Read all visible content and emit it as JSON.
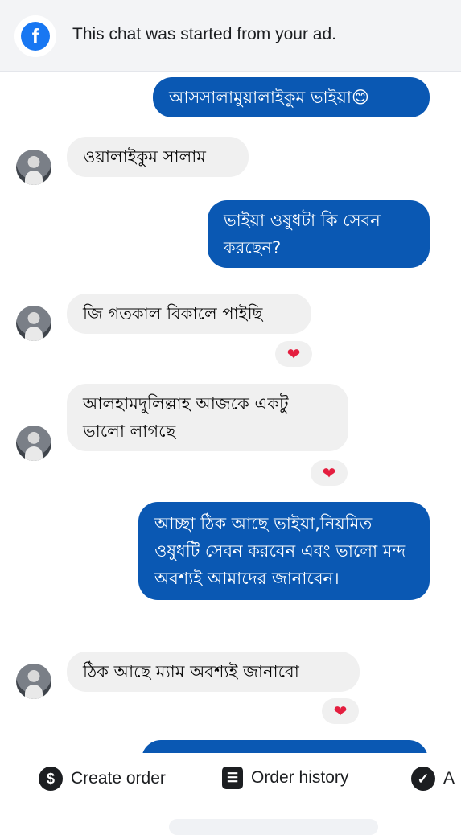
{
  "banner": {
    "icon": "facebook-icon",
    "text": "This chat was started from your ad."
  },
  "messages": [
    {
      "from": "me",
      "text": "আসসালামুয়ালাইকুম ভাইয়া😊"
    },
    {
      "from": "them",
      "text": "ওয়ালাইকুম সালাম"
    },
    {
      "from": "me",
      "text": "ভাইয়া ওষুধটা কি সেবন করছেন?"
    },
    {
      "from": "them",
      "text": "জি গতকাল বিকালে পাইছি",
      "reaction": "❤"
    },
    {
      "from": "them",
      "text": "আলহামদুলিল্লাহ আজকে একটু ভালো লাগছে",
      "reaction": "❤"
    },
    {
      "from": "me",
      "text": "আচ্ছা ঠিক আছে ভাইয়া,নিয়মিত ওষুধটি সেবন করবেন এবং ভালো মন্দ অবশ্যই আমাদের জানাবেন।"
    },
    {
      "from": "them",
      "text": "ঠিক আছে ম্যাম অবশ্যই জানাবো",
      "reaction": "❤"
    }
  ],
  "toolbar": {
    "create_order": {
      "label": "Create order",
      "icon": "dollar-icon",
      "glyph": "$"
    },
    "order_history": {
      "label": "Order history",
      "icon": "receipt-icon",
      "glyph": "☰"
    },
    "third": {
      "label": "A",
      "icon": "checkmark-icon",
      "glyph": "✓"
    }
  },
  "colors": {
    "outgoing_bubble": "#0a58b3",
    "incoming_bubble": "#f0f0f0",
    "facebook_blue": "#1877f2",
    "heart": "#e41e3f"
  }
}
